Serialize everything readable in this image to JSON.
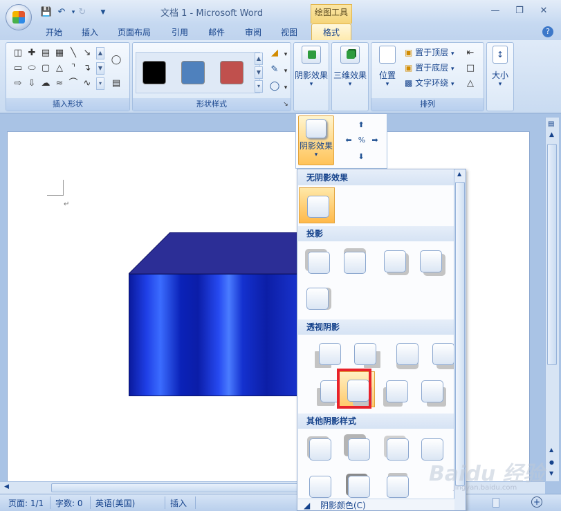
{
  "window": {
    "title": "文档 1 - Microsoft Word",
    "context_tab_group": "绘图工具"
  },
  "quick_access": {
    "save_icon": "save-icon",
    "undo_icon": "undo-icon",
    "redo_icon": "redo-icon",
    "customize_icon": "customize-icon"
  },
  "tabs": [
    "开始",
    "插入",
    "页面布局",
    "引用",
    "邮件",
    "审阅",
    "视图"
  ],
  "active_tab": "格式",
  "ribbon": {
    "groups": {
      "insert_shapes": "插入形状",
      "shape_styles": "形状样式",
      "arrange": "排列"
    },
    "style_swatches": [
      "#000000",
      "#4f81bd",
      "#c0504d"
    ],
    "shadow_effect": "阴影效果",
    "three_d_effect": "三维效果",
    "position": "位置",
    "bring_to_front": "置于顶层",
    "send_to_back": "置于底层",
    "text_wrap": "文字环绕",
    "size": "大小"
  },
  "flyout": {
    "shadow_effect_button": "阴影效果"
  },
  "gallery": {
    "no_shadow": "无阴影效果",
    "drop_shadow": "投影",
    "perspective_shadow": "透视阴影",
    "other_shadow": "其他阴影样式",
    "footer": "阴影颜色(C)"
  },
  "statusbar": {
    "page": "页面: 1/1",
    "words": "字数: 0",
    "language": "英语(美国)",
    "mode": "插入"
  },
  "watermark": {
    "brand": "Baidu 经验",
    "url": "jingyan.baidu.com"
  }
}
